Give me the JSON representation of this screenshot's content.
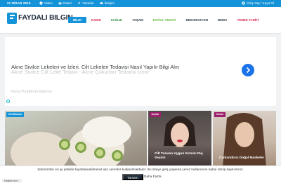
{
  "topbar": {
    "date": "21 NİSAN 2019",
    "links": [
      {
        "label": "Video",
        "icon": "video-icon"
      },
      {
        "label": "Galeri",
        "icon": "camera-icon"
      },
      {
        "label": "Yazarlar",
        "icon": "pencil-icon"
      },
      {
        "label": "İletişim",
        "icon": "mail-icon"
      }
    ],
    "login": "Giriş Yap / Kayıt Ol"
  },
  "logo": {
    "text": "FAYDALI BILGIN"
  },
  "nav": [
    {
      "label": "BİLGİ",
      "color": "#ffffff",
      "active": true
    },
    {
      "label": "KADIN",
      "color": "#d6214a"
    },
    {
      "label": "SAĞLIK",
      "color": "#2a8f3c"
    },
    {
      "label": "YAŞAM",
      "color": "#243241"
    },
    {
      "label": "DOĞAL TEDAVİ",
      "color": "#5fb839"
    },
    {
      "label": "DEKORASYON",
      "color": "#243241"
    },
    {
      "label": "MODA",
      "color": "#243241"
    },
    {
      "label": "YEMEK TARİFİ",
      "color": "#d6214a"
    }
  ],
  "ad": {
    "line1": "Akne Sivilce Lekeleri ve İzleri. Cilt Lekeleri Tedavisi Nasıl Yapılır Bilgi Alın",
    "line2": "Akne Sivilce Cilt Leke Tedavi - Akne Çukurları Tedavisi İzmir",
    "faded": "Nova Poliklinik Bulova"
  },
  "cards": [
    {
      "tag": "Cilt Bakımı",
      "tag_color": "#1493d8",
      "title": ""
    },
    {
      "tag": "Kadın",
      "tag_color": "#9c1f6b",
      "title": "Cilt Tonuna Uygun Kırmızı Ruj Seçimi"
    },
    {
      "tag": "Kadın",
      "tag_color": "#9c1f6b",
      "title": "Canlandırıcı Doğal Maskeler"
    }
  ],
  "cookie": {
    "text": "Sitemizden en iyi şekilde faydalanabilmeniz için çerezler kullanılmaktadır. Bu siteye giriş yaparak çerez kullanımını kabul etmiş sayılırsınız.",
    "accept": "Tamam",
    "more": "Daha Fazla"
  },
  "loading": "Bağlanıyor..."
}
